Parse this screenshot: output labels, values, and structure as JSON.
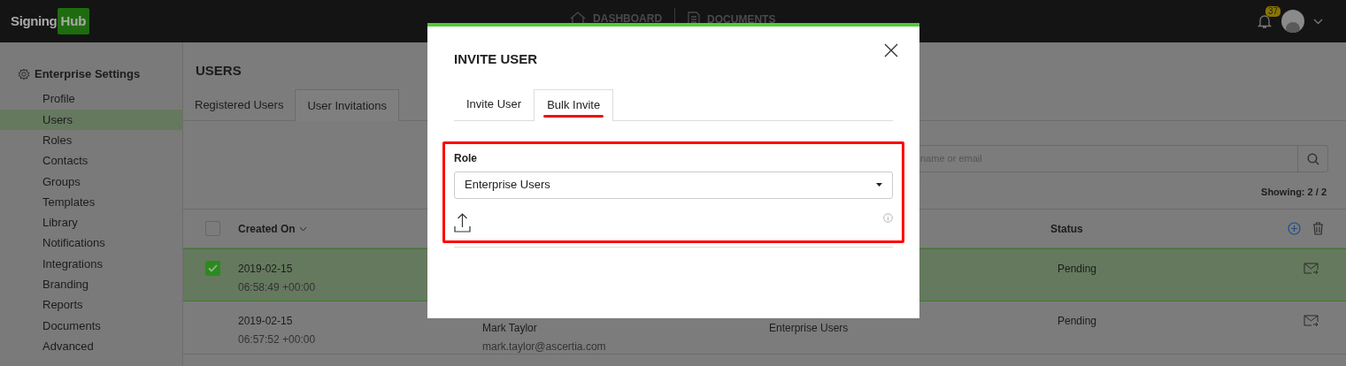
{
  "header": {
    "logo": {
      "text": "Signing",
      "highlight": "Hub"
    },
    "nav": [
      {
        "label": "DASHBOARD"
      },
      {
        "label": "DOCUMENTS"
      }
    ],
    "notifications": {
      "count": "37"
    }
  },
  "sidebar": {
    "title": "Enterprise Settings",
    "items": [
      {
        "label": "Profile",
        "selected": false
      },
      {
        "label": "Users",
        "selected": true
      },
      {
        "label": "Roles",
        "selected": false
      },
      {
        "label": "Contacts",
        "selected": false
      },
      {
        "label": "Groups",
        "selected": false
      },
      {
        "label": "Templates",
        "selected": false
      },
      {
        "label": "Library",
        "selected": false
      },
      {
        "label": "Notifications",
        "selected": false
      },
      {
        "label": "Integrations",
        "selected": false
      },
      {
        "label": "Branding",
        "selected": false
      },
      {
        "label": "Reports",
        "selected": false
      },
      {
        "label": "Documents",
        "selected": false
      },
      {
        "label": "Advanced",
        "selected": false
      }
    ]
  },
  "page": {
    "title": "USERS",
    "tabs": [
      {
        "label": "Registered Users",
        "selected": false
      },
      {
        "label": "User Invitations",
        "selected": true
      }
    ],
    "search": {
      "placeholder": "name or email"
    },
    "showing": "Showing: 2 / 2",
    "table": {
      "select_all": {
        "checked": false
      },
      "columns": [
        {
          "label": "Created On",
          "sortable": true
        },
        {
          "label": "Status",
          "sortable": false
        }
      ],
      "rows": [
        {
          "selected": true,
          "date": "2019-02-15",
          "time": "06:58:49 +00:00",
          "status": "Pending"
        },
        {
          "selected": false,
          "date": "2019-02-15",
          "time": "06:57:52 +00:00",
          "name": "Mark Taylor",
          "email": "mark.taylor@ascertia.com",
          "role": "Enterprise Users",
          "status": "Pending"
        }
      ]
    }
  },
  "modal": {
    "title": "INVITE USER",
    "tabs": [
      {
        "label": "Invite User",
        "selected": false
      },
      {
        "label": "Bulk Invite",
        "selected": true
      }
    ],
    "role": {
      "label": "Role",
      "value": "Enterprise Users"
    }
  }
}
